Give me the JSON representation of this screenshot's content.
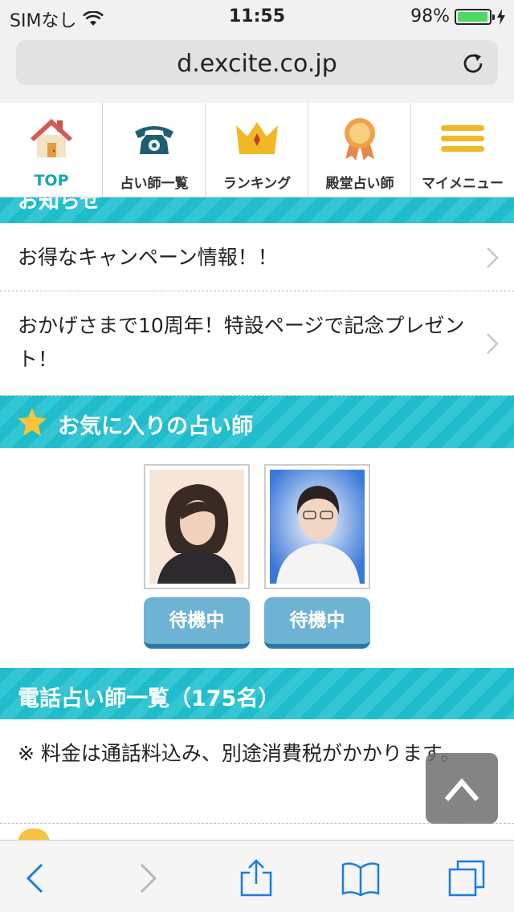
{
  "status_bar": {
    "carrier": "SIMなし",
    "time": "11:55",
    "battery_percent": "98%",
    "battery_level": 0.98,
    "battery_color": "#4cd964"
  },
  "browser": {
    "url": "d.excite.co.jp"
  },
  "nav": {
    "items": [
      {
        "label": "TOP",
        "icon": "house-icon",
        "active": true
      },
      {
        "label": "占い師一覧",
        "icon": "telephone-icon"
      },
      {
        "label": "ランキング",
        "icon": "crown-icon"
      },
      {
        "label": "殿堂占い師",
        "icon": "medal-icon"
      },
      {
        "label": "マイメニュー",
        "icon": "menu-icon"
      }
    ],
    "accent_color": "#1aa5b0"
  },
  "notices": {
    "title": "お知らせ",
    "items": [
      {
        "text": "お得なキャンペーン情報！！"
      },
      {
        "text": "おかげさまで10周年！特設ページで記念プレゼント！"
      }
    ]
  },
  "favorites": {
    "title": "お気に入りの占い師",
    "fortune_tellers": [
      {
        "status": "待機中"
      },
      {
        "status": "待機中"
      }
    ]
  },
  "phone_list": {
    "title": "電話占い師一覧（175名）",
    "note": "※ 料金は通話料込み、別途消費税がかかります。"
  },
  "colors": {
    "section_teal": "#20bccb",
    "wait_button": "#6fb3d4",
    "toolbar_tint": "#1a7ce0"
  }
}
